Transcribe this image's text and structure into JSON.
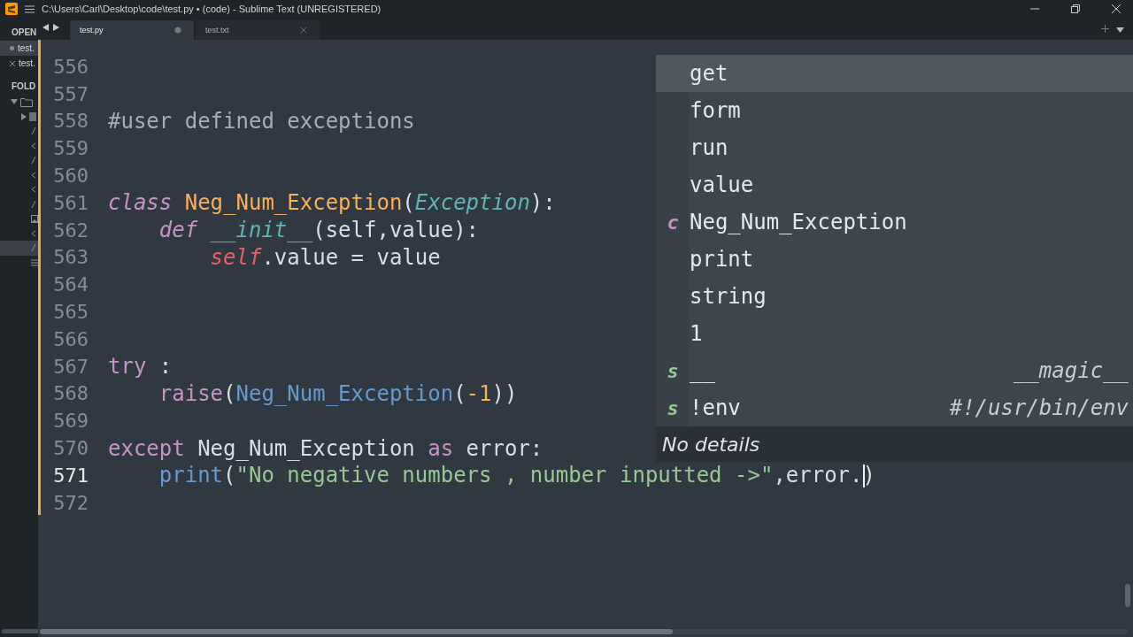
{
  "window": {
    "title": "C:\\Users\\Carl\\Desktop\\code\\test.py • (code) - Sublime Text (UNREGISTERED)"
  },
  "sidebar": {
    "open_header": "OPEN",
    "open_files": [
      {
        "name": "test.",
        "selected": true,
        "dirty": true
      },
      {
        "name": "test.",
        "selected": false,
        "dirty": false
      }
    ],
    "folders_header": "FOLD"
  },
  "tabs": [
    {
      "label": "test.py",
      "selected": true,
      "dirty": true
    },
    {
      "label": "test.txt",
      "selected": false,
      "dirty": false
    }
  ],
  "editor": {
    "lines": [
      {
        "number": "556",
        "current": false
      },
      {
        "number": "557",
        "current": false
      },
      {
        "number": "558",
        "current": false,
        "tokens": [
          {
            "text": "#user defined exceptions",
            "kind": "comment"
          }
        ]
      },
      {
        "number": "559",
        "current": false
      },
      {
        "number": "560",
        "current": false
      },
      {
        "number": "561",
        "current": false,
        "tokens": [
          {
            "text": "class",
            "kind": "storage"
          },
          {
            "text": " Neg_Num_Exception",
            "kind": "entity"
          },
          {
            "text": "(",
            "kind": "punct"
          },
          {
            "text": "Exception",
            "kind": "inherited"
          },
          {
            "text": "):",
            "kind": "punct"
          }
        ]
      },
      {
        "number": "562",
        "current": false,
        "tokens": [
          {
            "text": "    def",
            "kind": "storage"
          },
          {
            "text": " __init__",
            "kind": "function"
          },
          {
            "text": "(self,value):",
            "kind": "punct"
          }
        ]
      },
      {
        "number": "563",
        "current": false,
        "tokens": [
          {
            "text": "        self",
            "kind": "self"
          },
          {
            "text": ".value = value",
            "kind": "plain"
          }
        ]
      },
      {
        "number": "564",
        "current": false
      },
      {
        "number": "565",
        "current": false
      },
      {
        "number": "566",
        "current": false
      },
      {
        "number": "567",
        "current": false,
        "tokens": [
          {
            "text": "try",
            "kind": "keyword"
          },
          {
            "text": " :",
            "kind": "plain"
          }
        ]
      },
      {
        "number": "568",
        "current": false,
        "tokens": [
          {
            "text": "    raise",
            "kind": "keyword"
          },
          {
            "text": "(",
            "kind": "punct"
          },
          {
            "text": "Neg_Num_Exception",
            "kind": "call"
          },
          {
            "text": "(",
            "kind": "punct"
          },
          {
            "text": "-1",
            "kind": "number"
          },
          {
            "text": "))",
            "kind": "punct"
          }
        ]
      },
      {
        "number": "569",
        "current": false
      },
      {
        "number": "570",
        "current": false,
        "tokens": [
          {
            "text": "except",
            "kind": "keyword"
          },
          {
            "text": " Neg_Num_Exception ",
            "kind": "plain"
          },
          {
            "text": "as",
            "kind": "keyword"
          },
          {
            "text": " error:",
            "kind": "plain"
          }
        ]
      },
      {
        "number": "571",
        "current": true,
        "tokens": [
          {
            "text": "    print",
            "kind": "call"
          },
          {
            "text": "(",
            "kind": "punct"
          },
          {
            "text": "\"No negative numbers , number inputted ->\"",
            "kind": "string"
          },
          {
            "text": ",error.",
            "kind": "plain"
          },
          {
            "text": ")",
            "kind": "punct",
            "caret_before": true
          }
        ]
      },
      {
        "number": "572",
        "current": false
      }
    ]
  },
  "autocomplete": {
    "items": [
      {
        "label": "get",
        "kind": "plain",
        "selected": true
      },
      {
        "label": "form",
        "kind": "plain",
        "selected": false
      },
      {
        "label": "run",
        "kind": "plain",
        "selected": false
      },
      {
        "label": "value",
        "kind": "plain",
        "selected": false
      },
      {
        "label": "Neg_Num_Exception",
        "kind": "class",
        "badge": "c",
        "selected": false
      },
      {
        "label": "print",
        "kind": "plain",
        "selected": false
      },
      {
        "label": "string",
        "kind": "plain",
        "selected": false
      },
      {
        "label": "1",
        "kind": "plain",
        "selected": false
      },
      {
        "label": "__",
        "kind": "snippet",
        "badge": "s",
        "annotation": "__magic__",
        "selected": false
      },
      {
        "label": "!env",
        "kind": "snippet",
        "badge": "s",
        "annotation": "#!/usr/bin/env",
        "selected": false
      }
    ],
    "details": "No details"
  }
}
